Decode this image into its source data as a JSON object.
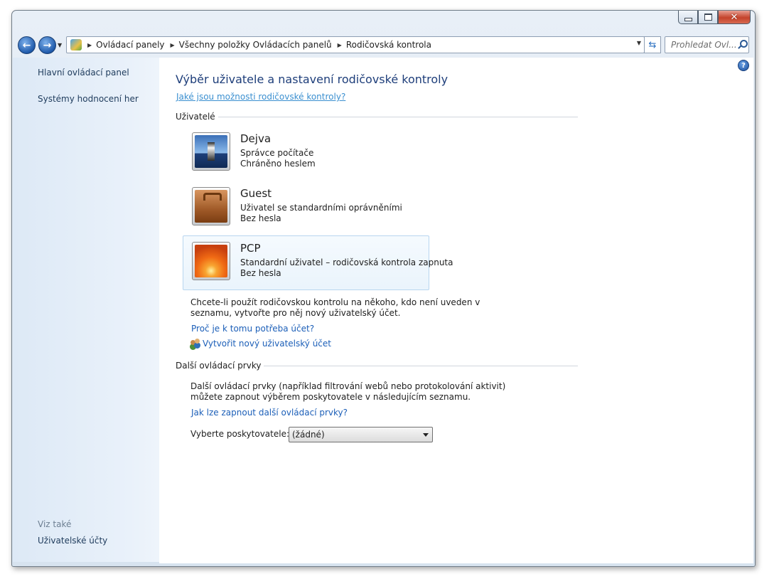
{
  "window": {
    "buttons": {
      "minimize_icon": "minimize-icon",
      "maximize_icon": "maximize-icon",
      "close_glyph": "✕"
    }
  },
  "navigation": {
    "back_glyph": "←",
    "forward_glyph": "→",
    "breadcrumbs": [
      "Ovládací panely",
      "Všechny položky Ovládacích panelů",
      "Rodičovská kontrola"
    ],
    "refresh_glyph": "⇆",
    "search_placeholder": "Prohledat Ovl..."
  },
  "sidebar": {
    "links": [
      "Hlavní ovládací panel",
      "Systémy hodnocení her"
    ],
    "see_also_heading": "Viz také",
    "see_also_links": [
      "Uživatelské účty"
    ]
  },
  "main": {
    "help_glyph": "?",
    "title": "Výběr uživatele a nastavení rodičovské kontroly",
    "title_link": "Jaké jsou možnosti rodičovské kontroly?",
    "users_section": "Uživatelé",
    "users": [
      {
        "name": "Dejva",
        "line1": "Správce počítače",
        "line2": "Chráněno heslem",
        "picture": "lighthouse-picture",
        "selected": false
      },
      {
        "name": "Guest",
        "line1": "Uživatel se standardními oprávněními",
        "line2": "Bez hesla",
        "picture": "suitcase-picture",
        "selected": false
      },
      {
        "name": "PCP",
        "line1": "Standardní uživatel – rodičovská kontrola zapnuta",
        "line2": "Bez hesla",
        "picture": "flower-picture",
        "selected": true
      }
    ],
    "no_user_text_line1": "Chcete-li použít rodičovskou kontrolu na někoho, kdo není uveden v",
    "no_user_text_line2": "seznamu, vytvořte pro něj nový uživatelský účet.",
    "why_account_link": "Proč je k tomu potřeba účet?",
    "create_account_link": "Vytvořit nový uživatelský účet",
    "more_controls_section": "Další ovládací prvky",
    "more_controls_text_line1": "Další ovládací prvky (například filtrování webů nebo protokolování aktivit)",
    "more_controls_text_line2": "můžete zapnout výběrem poskytovatele v následujícím seznamu.",
    "more_controls_link": "Jak lze zapnout další ovládací prvky?",
    "provider_label": "Vyberte poskytovatele:",
    "provider_value": "(žádné)"
  }
}
